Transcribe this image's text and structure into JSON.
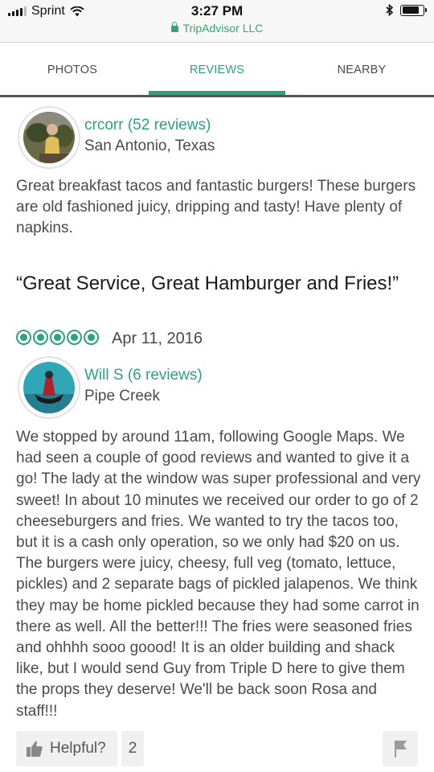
{
  "status_bar": {
    "carrier": "Sprint",
    "time": "3:27 PM",
    "site": "TripAdvisor LLC",
    "battery_level": 0.8
  },
  "tabs": [
    {
      "label": "PHOTOS",
      "active": false
    },
    {
      "label": "REVIEWS",
      "active": true
    },
    {
      "label": "NEARBY",
      "active": false
    }
  ],
  "reviews": [
    {
      "username": "crcorr (52 reviews)",
      "location": "San Antonio, Texas",
      "text": "Great breakfast tacos and fantastic burgers! These burgers are old fashioned juicy, dripping and tasty! Have plenty of napkins."
    },
    {
      "title": "“Great Service, Great Hamburger and Fries!”",
      "rating": 5,
      "date": "Apr 11, 2016",
      "username": "Will S (6 reviews)",
      "location": "Pipe Creek",
      "text": "We stopped by around 11am, following Google Maps. We had seen a couple of good reviews and wanted to give it a go! The lady at the window was super professional and very sweet! In about 10 minutes we received our order to go of 2 cheeseburgers and fries. We wanted to try the tacos too, but it is a cash only operation, so we only had $20 on us. The burgers were juicy, cheesy, full veg (tomato, lettuce, pickles) and 2 separate bags of pickled jalapenos. We think they may be home pickled because they had some carrot in there as well. All the better!!! The fries were seasoned fries and ohhhh sooo goood! It is an older building and shack like, but I would send Guy from Triple D here to give them the props they deserve! We'll be back soon Rosa and staff!!!"
    }
  ],
  "actions": {
    "helpful_label": "Helpful?",
    "helpful_count": "2"
  },
  "icons": {
    "signal": "signal-icon",
    "wifi": "wifi-icon",
    "bluetooth": "bluetooth-icon",
    "battery": "battery-icon",
    "lock": "lock-icon",
    "thumb": "thumbs-up-icon",
    "flag": "flag-icon"
  },
  "colors": {
    "accent": "#2aa37f",
    "secure": "#37a66f"
  }
}
